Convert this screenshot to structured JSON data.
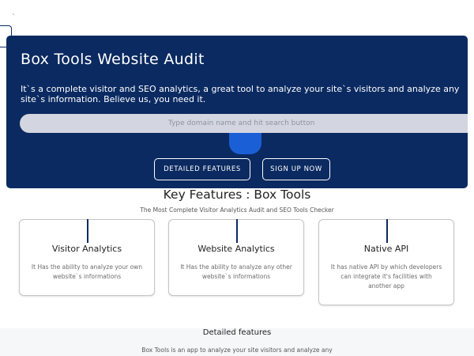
{
  "hero": {
    "title": "Box Tools Website Audit",
    "description": "It`s a complete visitor and SEO analytics, a great tool to analyze your site`s visitors and analyze any site`s information. Believe us, you need it.",
    "search_placeholder": "Type domain name and hit search button",
    "search_button_icon": "search-button",
    "buttons": {
      "features": "DETAILED FEATURES",
      "signup": "SIGN UP NOW"
    }
  },
  "key_features": {
    "title": "Key Features : Box Tools",
    "subtitle": "The Most Complete Visitor Analytics Audit and SEO Tools Checker",
    "cards": [
      {
        "title": "Visitor Analytics",
        "description": "It Has the ability to analyze your own website`s informations"
      },
      {
        "title": "Website Analytics",
        "description": "It Has the ability to analyze any other website`s informations"
      },
      {
        "title": "Native API",
        "description": "It has native API by which developers can integrate it's facilities with another app"
      }
    ]
  },
  "detailed": {
    "title": "Detailed features",
    "text": "Box Tools is an app to analyze your site visitors and analyze any"
  },
  "colors": {
    "hero_background": "#0b2a61",
    "search_bar": "#d3d6e0",
    "search_button": "#1b5fd6"
  }
}
